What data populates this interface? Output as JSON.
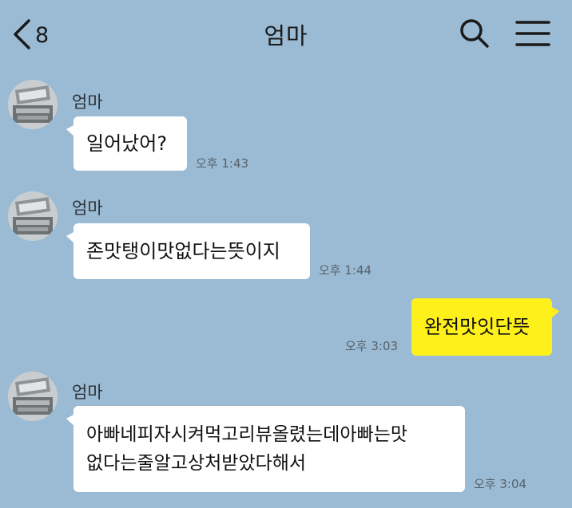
{
  "header": {
    "back_count": "8",
    "title": "엄마"
  },
  "messages": [
    {
      "sender": "엄마",
      "text": "일어났어?",
      "time": "오후 1:43",
      "direction": "incoming"
    },
    {
      "sender": "엄마",
      "text": "존맛탱이맛없다는뜻이지",
      "time": "오후 1:44",
      "direction": "incoming"
    },
    {
      "text": "완전맛잇단뜻",
      "time": "오후 3:03",
      "direction": "outgoing"
    },
    {
      "sender": "엄마",
      "text": "아빠네피자시켜먹고리뷰올렸는데아빠는맛\n없다는줄알고상처받았다해서",
      "time": "오후 3:04",
      "direction": "incoming"
    }
  ],
  "colors": {
    "background": "#9bbbd4",
    "incoming_bubble": "#ffffff",
    "outgoing_bubble": "#fef01b"
  },
  "icons": [
    "chevron-left-icon",
    "search-icon",
    "menu-icon",
    "avatar"
  ]
}
